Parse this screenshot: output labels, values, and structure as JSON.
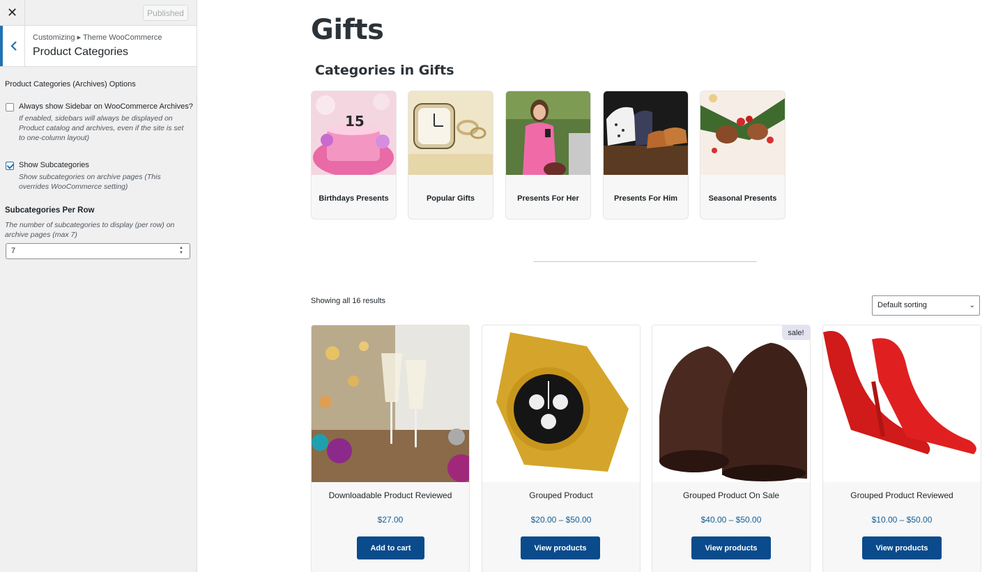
{
  "customizer": {
    "close_glyph": "✕",
    "published_label": "Published",
    "breadcrumb": "Customizing ▸ Theme WooCommerce",
    "section_title": "Product Categories",
    "options_heading": "Product Categories (Archives) Options",
    "sidebar_option": {
      "label": "Always show Sidebar on WooCommerce Archives?",
      "checked": false,
      "description": "If enabled, sidebars will always be displayed on Product catalog and archives, even if the site is set to one-column layout)"
    },
    "subcat_option": {
      "label": "Show Subcategories",
      "checked": true,
      "description": "Show subcategories on archive pages (This overrides WooCommerce setting)"
    },
    "per_row": {
      "label": "Subcategories Per Row",
      "description": "The number of subcategories to display (per row) on archive pages (max 7)",
      "value": "7"
    }
  },
  "preview": {
    "page_title": "Gifts",
    "categories_heading": "Categories in Gifts",
    "categories": [
      {
        "label": "Birthdays Presents",
        "icon": "birthday-cake-image"
      },
      {
        "label": "Popular Gifts",
        "icon": "watch-and-rings-image"
      },
      {
        "label": "Presents For Her",
        "icon": "woman-with-phone-image"
      },
      {
        "label": "Presents For Him",
        "icon": "shirts-and-shoes-image"
      },
      {
        "label": "Seasonal Presents",
        "icon": "christmas-ornaments-image"
      }
    ],
    "results_text": "Showing all 16 results",
    "sort_label": "Default sorting",
    "products": [
      {
        "name": "Downloadable Product Reviewed",
        "price": "$27.00",
        "button": "Add to cart",
        "sale": ""
      },
      {
        "name": "Grouped Product",
        "price": "$20.00 – $50.00",
        "button": "View products",
        "sale": ""
      },
      {
        "name": "Grouped Product On Sale",
        "price": "$40.00 – $50.00",
        "button": "View products",
        "sale": "sale!"
      },
      {
        "name": "Grouped Product Reviewed",
        "price": "$10.00 – $50.00",
        "button": "View products",
        "sale": ""
      }
    ]
  },
  "colors": {
    "accent": "#2271b1",
    "button": "#0a4b8c",
    "price": "#135e96"
  }
}
